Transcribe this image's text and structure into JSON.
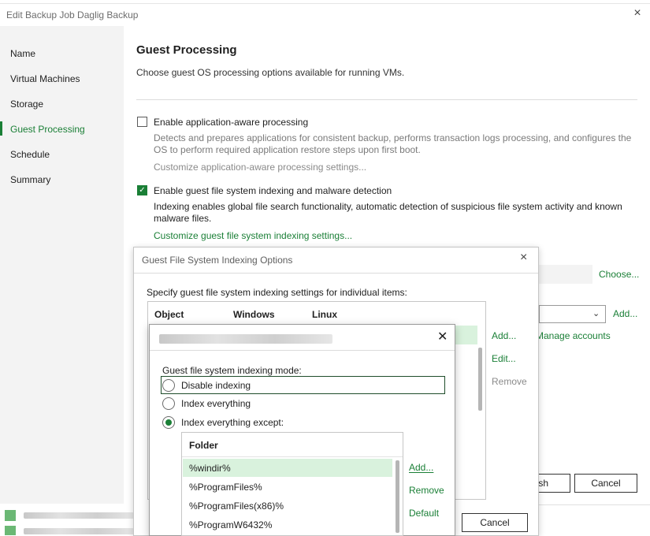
{
  "window": {
    "title": "Edit Backup Job Daglig Backup",
    "close_icon": "×"
  },
  "sidebar": {
    "items": [
      {
        "label": "Name",
        "active": false
      },
      {
        "label": "Virtual Machines",
        "active": false
      },
      {
        "label": "Storage",
        "active": false
      },
      {
        "label": "Guest Processing",
        "active": true
      },
      {
        "label": "Schedule",
        "active": false
      },
      {
        "label": "Summary",
        "active": false
      }
    ]
  },
  "main": {
    "title": "Guest Processing",
    "subtitle": "Choose guest OS processing options available for running VMs.",
    "app_aware": {
      "label": "Enable application-aware processing",
      "checked": false,
      "description": "Detects and prepares applications for consistent backup, performs transaction logs processing, and configures the OS to perform required application restore steps upon first boot.",
      "link": "Customize application-aware processing settings..."
    },
    "indexing": {
      "label": "Enable guest file system indexing and malware detection",
      "checked": true,
      "description": "Indexing enables global file search functionality, automatic detection of suspicious file system activity and known malware files.",
      "link": "Customize guest file system indexing settings..."
    },
    "choose_link": "Choose...",
    "add_link": "Add...",
    "manage_accounts_link": "Manage accounts",
    "finish_button_partial": "ish",
    "cancel_button": "Cancel"
  },
  "dialog_options": {
    "title": "Guest File System Indexing Options",
    "close_icon": "×",
    "instruction": "Specify guest file system indexing settings for individual items:",
    "columns": [
      "Object",
      "Windows",
      "Linux"
    ],
    "add_button": "Add...",
    "edit_button": "Edit...",
    "remove_button": "Remove",
    "cancel_button": "Cancel"
  },
  "dialog_settings": {
    "close_icon": "✕",
    "mode_label": "Guest file system indexing mode:",
    "modes": [
      "Disable indexing",
      "Index everything",
      "Index everything except:"
    ],
    "selected_mode_index": 2,
    "folder_header": "Folder",
    "folders": [
      "%windir%",
      "%ProgramFiles%",
      "%ProgramFiles(x86)%",
      "%ProgramW6432%"
    ],
    "add_button": "Add...",
    "remove_button": "Remove",
    "default_button": "Default"
  },
  "colors": {
    "accent": "#1a7f36",
    "selected_row": "#d9f2dd"
  }
}
